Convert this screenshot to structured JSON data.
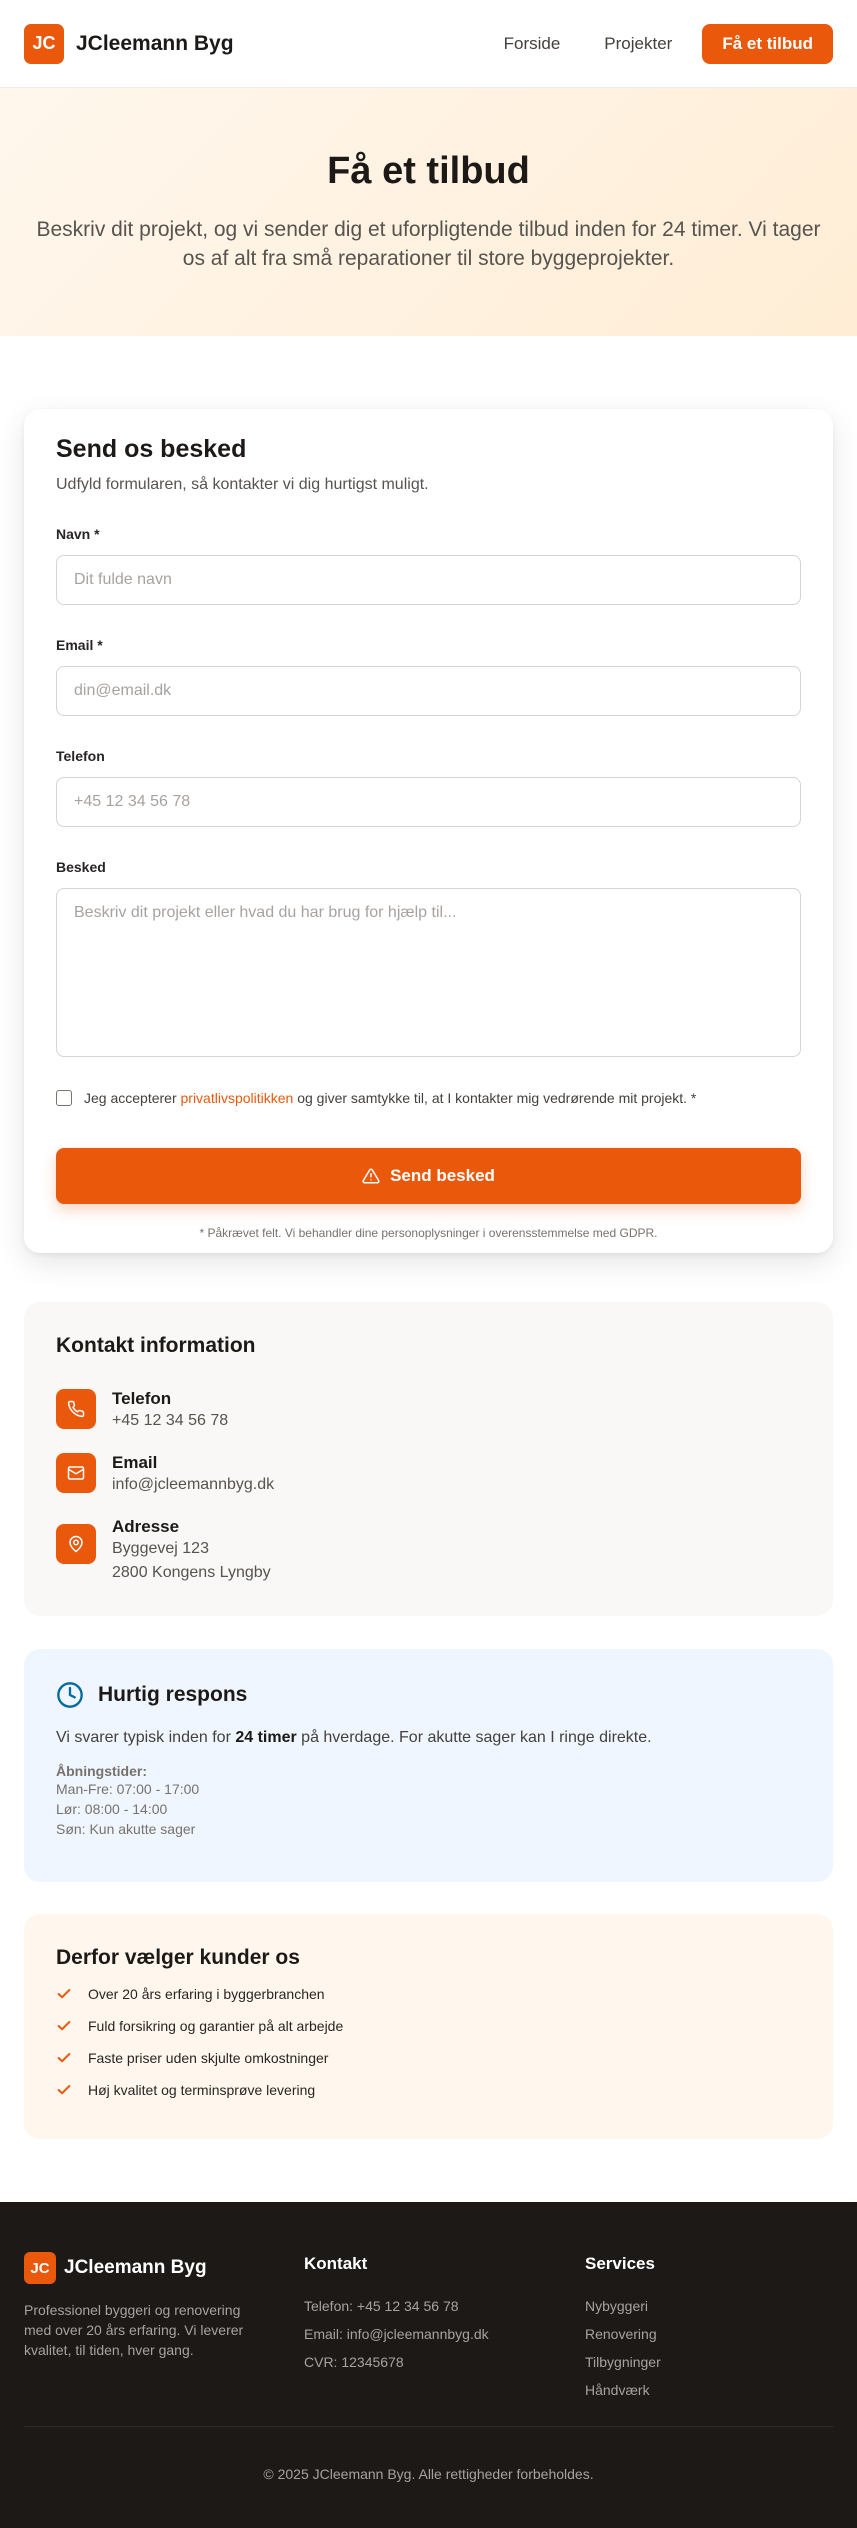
{
  "header": {
    "logo_text": "JC",
    "brand": "JCleemann Byg",
    "nav": [
      "Forside",
      "Projekter"
    ],
    "cta": "Få et tilbud"
  },
  "hero": {
    "title": "Få et tilbud",
    "subtitle": "Beskriv dit projekt, og vi sender dig et uforpligtende tilbud inden for 24 timer. Vi tager os af alt fra små reparationer til store byggeprojekter."
  },
  "form": {
    "title": "Send os besked",
    "subtitle": "Udfyld formularen, så kontakter vi dig hurtigst muligt.",
    "name_label": "Navn *",
    "name_placeholder": "Dit fulde navn",
    "email_label": "Email *",
    "email_placeholder": "din@email.dk",
    "phone_label": "Telefon",
    "phone_placeholder": "+45 12 34 56 78",
    "message_label": "Besked",
    "message_placeholder": "Beskriv dit projekt eller hvad du har brug for hjælp til...",
    "consent_prefix": "Jeg accepterer ",
    "consent_link": "privatlivspolitikken",
    "consent_suffix": " og giver samtykke til, at I kontakter mig vedrørende mit projekt. *",
    "submit_label": "Send besked",
    "note": "* Påkrævet felt. Vi behandler dine personoplysninger i overensstemmelse med GDPR."
  },
  "contact": {
    "title": "Kontakt information",
    "phone_title": "Telefon",
    "phone_value": "+45 12 34 56 78",
    "email_title": "Email",
    "email_value": "info@jcleemannbyg.dk",
    "address_title": "Adresse",
    "address_line1": "Byggevej 123",
    "address_line2": "2800 Kongens Lyngby"
  },
  "response": {
    "title": "Hurtig respons",
    "text_prefix": "Vi svarer typisk inden for ",
    "text_bold": "24 timer",
    "text_suffix": " på hverdage. For akutte sager kan I ringe direkte.",
    "hours_title": "Åbningstider:",
    "hours": [
      "Man-Fre: 07:00 - 17:00",
      "Lør: 08:00 - 14:00",
      "Søn: Kun akutte sager"
    ]
  },
  "why": {
    "title": "Derfor vælger kunder os",
    "items": [
      "Over 20 års erfaring i byggerbranchen",
      "Fuld forsikring og garantier på alt arbejde",
      "Faste priser uden skjulte omkostninger",
      "Høj kvalitet og terminsprøve levering"
    ]
  },
  "footer": {
    "logo_text": "JC",
    "brand": "JCleemann Byg",
    "description": "Professionel byggeri og renovering med over 20 års erfaring. Vi leverer kvalitet, til tiden, hver gang.",
    "contact_title": "Kontakt",
    "contact_lines": [
      "Telefon: +45 12 34 56 78",
      "Email: info@jcleemannbyg.dk",
      "CVR: 12345678"
    ],
    "services_title": "Services",
    "services": [
      "Nybyggeri",
      "Renovering",
      "Tilbygninger",
      "Håndværk"
    ],
    "copyright": "© 2025 JCleemann Byg. Alle rettigheder forbeholdes."
  },
  "colors": {
    "accent": "#ea580c",
    "hero_bg": "#fff7ed",
    "footer_bg": "#1c1917",
    "response_bg": "#eff6ff",
    "response_icon": "#0369a1"
  },
  "icons": {
    "submit": "warning-triangle-icon",
    "phone": "phone-icon",
    "email": "mail-icon",
    "address": "map-pin-icon",
    "response": "clock-icon",
    "why": "check-icon"
  }
}
